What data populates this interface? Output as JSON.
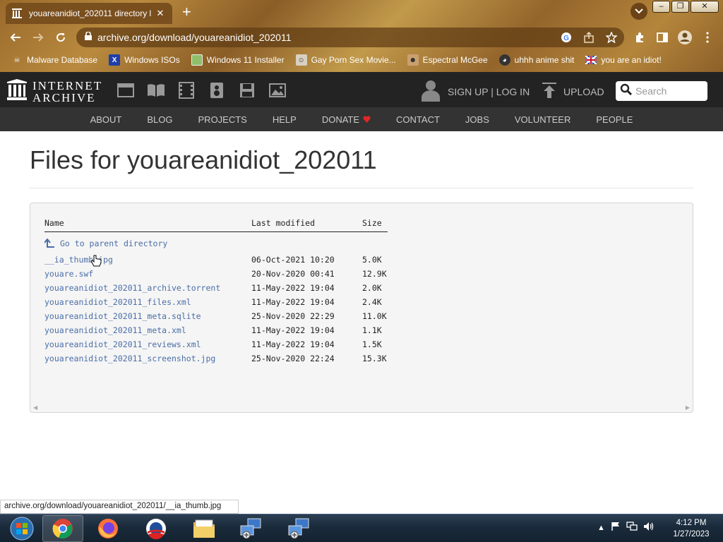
{
  "browser": {
    "tab_title": "youareanidiot_202011 directory l",
    "tab_close": "✕",
    "new_tab": "+",
    "url": "archive.org/download/youareanidiot_202011",
    "bookmarks": [
      {
        "label": "Malware Database",
        "icon": "skull-icon"
      },
      {
        "label": "Windows ISOs",
        "icon": "x-logo-icon"
      },
      {
        "label": "Windows 11 Installer",
        "icon": "image-icon"
      },
      {
        "label": "Gay Porn Sex Movie...",
        "icon": "face-icon"
      },
      {
        "label": "Espectral McGee",
        "icon": "character-icon"
      },
      {
        "label": "uhhh anime shit",
        "icon": "anime-icon"
      },
      {
        "label": "you are an idiot!",
        "icon": "uk-flag-icon"
      }
    ]
  },
  "ia_header": {
    "logo_line1": "INTERNET",
    "logo_line2": "ARCHIVE",
    "media_icons": [
      "web-icon",
      "texts-icon",
      "video-icon",
      "audio-icon",
      "software-icon",
      "images-icon"
    ],
    "signup": "SIGN UP | LOG IN",
    "upload": "UPLOAD",
    "search_placeholder": "Search",
    "nav": [
      "ABOUT",
      "BLOG",
      "PROJECTS",
      "HELP",
      "DONATE",
      "CONTACT",
      "JOBS",
      "VOLUNTEER",
      "PEOPLE"
    ],
    "donate_heart_color": "#e02626"
  },
  "page": {
    "title": "Files for youareanidiot_202011",
    "columns": {
      "name": "Name",
      "modified": "Last modified",
      "size": "Size"
    },
    "parent_link": "Go to parent directory",
    "files": [
      {
        "name": "__ia_thumb.jpg",
        "modified": "06-Oct-2021 10:20",
        "size": "5.0K"
      },
      {
        "name": "youare.swf",
        "modified": "20-Nov-2020 00:41",
        "size": "12.9K"
      },
      {
        "name": "youareanidiot_202011_archive.torrent",
        "modified": "11-May-2022 19:04",
        "size": "2.0K"
      },
      {
        "name": "youareanidiot_202011_files.xml",
        "modified": "11-May-2022 19:04",
        "size": "2.4K"
      },
      {
        "name": "youareanidiot_202011_meta.sqlite",
        "modified": "25-Nov-2020 22:29",
        "size": "11.0K"
      },
      {
        "name": "youareanidiot_202011_meta.xml",
        "modified": "11-May-2022 19:04",
        "size": "1.1K"
      },
      {
        "name": "youareanidiot_202011_reviews.xml",
        "modified": "11-May-2022 19:04",
        "size": "1.5K"
      },
      {
        "name": "youareanidiot_202011_screenshot.jpg",
        "modified": "25-Nov-2020 22:24",
        "size": "15.3K"
      }
    ],
    "link_color": "#4a6ea8"
  },
  "status_bar": "archive.org/download/youareanidiot_202011/__ia_thumb.jpg",
  "taskbar": {
    "apps": [
      "start-orb-icon",
      "chrome-icon",
      "firefox-icon",
      "obama-logo-icon",
      "file-explorer-icon",
      "network-setup-icon",
      "network-setup-icon"
    ],
    "time": "4:12 PM",
    "date": "1/27/2023"
  }
}
